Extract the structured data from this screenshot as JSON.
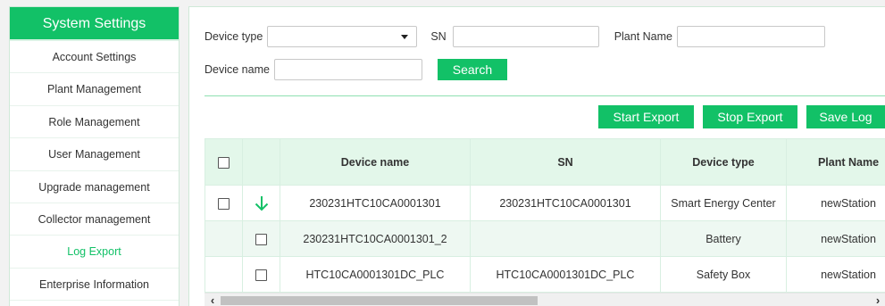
{
  "sidebar": {
    "title": "System Settings",
    "items": [
      {
        "label": "Account Settings"
      },
      {
        "label": "Plant Management"
      },
      {
        "label": "Role Management"
      },
      {
        "label": "User Management"
      },
      {
        "label": "Upgrade management"
      },
      {
        "label": "Collector management"
      },
      {
        "label": "Log Export",
        "active": true
      },
      {
        "label": "Enterprise Information"
      }
    ]
  },
  "filters": {
    "device_type_label": "Device type",
    "device_type_value": "",
    "sn_label": "SN",
    "sn_value": "",
    "plant_name_label": "Plant Name",
    "plant_name_value": "",
    "device_name_label": "Device name",
    "device_name_value": "",
    "search_button": "Search"
  },
  "actions": {
    "start_export": "Start Export",
    "stop_export": "Stop Export",
    "save_log": "Save Log"
  },
  "table": {
    "headers": {
      "device_name": "Device name",
      "sn": "SN",
      "device_type": "Device type",
      "plant_name": "Plant Name"
    },
    "rows": [
      {
        "device_name": "230231HTC10CA0001301",
        "sn": "230231HTC10CA0001301",
        "device_type": "Smart Energy Center",
        "plant_name": "newStation"
      },
      {
        "device_name": "230231HTC10CA0001301_2",
        "sn": "",
        "device_type": "Battery",
        "plant_name": "newStation"
      },
      {
        "device_name": "HTC10CA0001301DC_PLC",
        "sn": "HTC10CA0001301DC_PLC",
        "device_type": "Safety Box",
        "plant_name": "newStation"
      }
    ]
  },
  "colors": {
    "accent": "#12c167",
    "header_bg": "#e3f7ea",
    "row_alt_bg": "#eef8f2"
  },
  "icons": {
    "expand": "arrow-down-icon",
    "scroll_left": "chevron-left-icon",
    "scroll_right": "chevron-right-icon",
    "dropdown": "caret-down-icon"
  }
}
